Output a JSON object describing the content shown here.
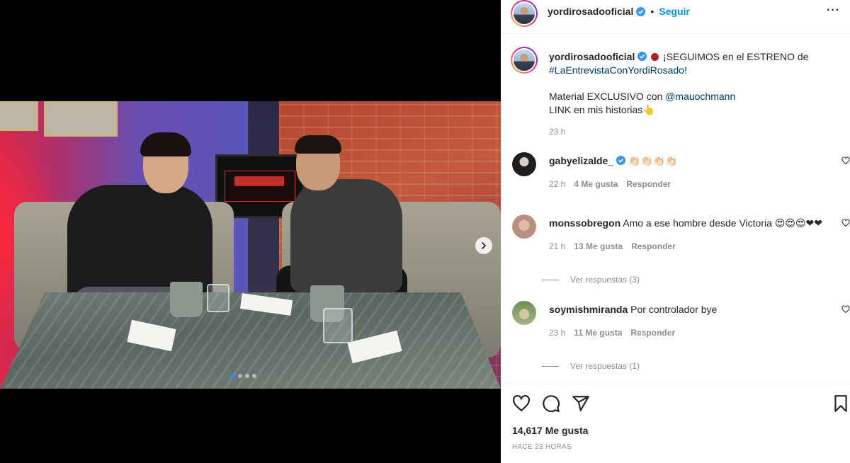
{
  "post": {
    "slide_count": 4,
    "active_slide": 1
  },
  "header": {
    "username": "yordirosadooficial",
    "separator": "•",
    "follow_label": "Seguir",
    "more_label": "···"
  },
  "caption": {
    "username": "yordirosadooficial",
    "text_intro": "¡SEGUIMOS en el ESTRENO de",
    "hashtag": "#LaEntrevistaConYordiRosado!",
    "line2_prefix": "Material EXCLUSIVO con",
    "mention": "@mauochmann",
    "line3": "LINK en mis historias👆",
    "time": "23 h"
  },
  "comments": [
    {
      "username": "gabyelizalde_",
      "text": "👏🏻👏🏻👏🏻👏🏻",
      "time": "22 h",
      "likes": "4 Me gusta",
      "reply": "Responder"
    },
    {
      "username": "monssobregon",
      "text": "Amo a ese hombre desde Victoria 😍😍😍❤❤",
      "time": "21 h",
      "likes": "13 Me gusta",
      "reply": "Responder",
      "view_replies": "Ver respuestas (3)"
    },
    {
      "username": "soymishmiranda",
      "text": "Por controlador bye",
      "time": "23 h",
      "likes": "11 Me gusta",
      "reply": "Responder",
      "view_replies": "Ver respuestas (1)"
    }
  ],
  "footer": {
    "likes": "14,617 Me gusta",
    "ago": "HACE 23 HORAS"
  },
  "colors": {
    "link_blue": "#0095f6",
    "hashtag_blue": "#00376b",
    "muted": "#8e8e8e",
    "active_dot": "#2f8bff"
  },
  "icons": [
    "verified-icon",
    "more-icon",
    "heart-icon",
    "comment-icon",
    "share-icon",
    "bookmark-icon",
    "chevron-right-icon"
  ]
}
